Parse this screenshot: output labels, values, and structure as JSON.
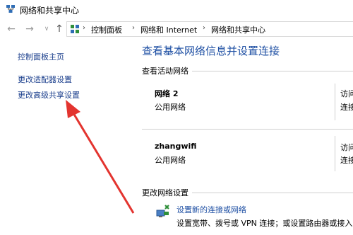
{
  "window": {
    "title": "网络和共享中心"
  },
  "address_bar": {
    "crumbs": [
      "控制面板",
      "网络和 Internet",
      "网络和共享中心"
    ]
  },
  "left_nav": {
    "home": "控制面板主页",
    "adapter": "更改适配器设置",
    "advanced": "更改高级共享设置"
  },
  "main": {
    "title": "查看基本网络信息并设置连接",
    "active_label": "查看活动网络",
    "networks": [
      {
        "name": "网络 2",
        "type": "公用网络",
        "access_label": "访问",
        "conn_label": "连接"
      },
      {
        "name": "zhangwifi",
        "type": "公用网络",
        "access_label": "访问",
        "conn_label": "连接"
      }
    ],
    "change_label": "更改网络设置",
    "setup_link": "设置新的连接或网络",
    "setup_desc": "设置宽带、拨号或 VPN 连接；或设置路由器或接入点"
  },
  "colors": {
    "link": "#1e4fa3",
    "nav_link": "#1a3e8c",
    "arrow": "#e3342f"
  }
}
